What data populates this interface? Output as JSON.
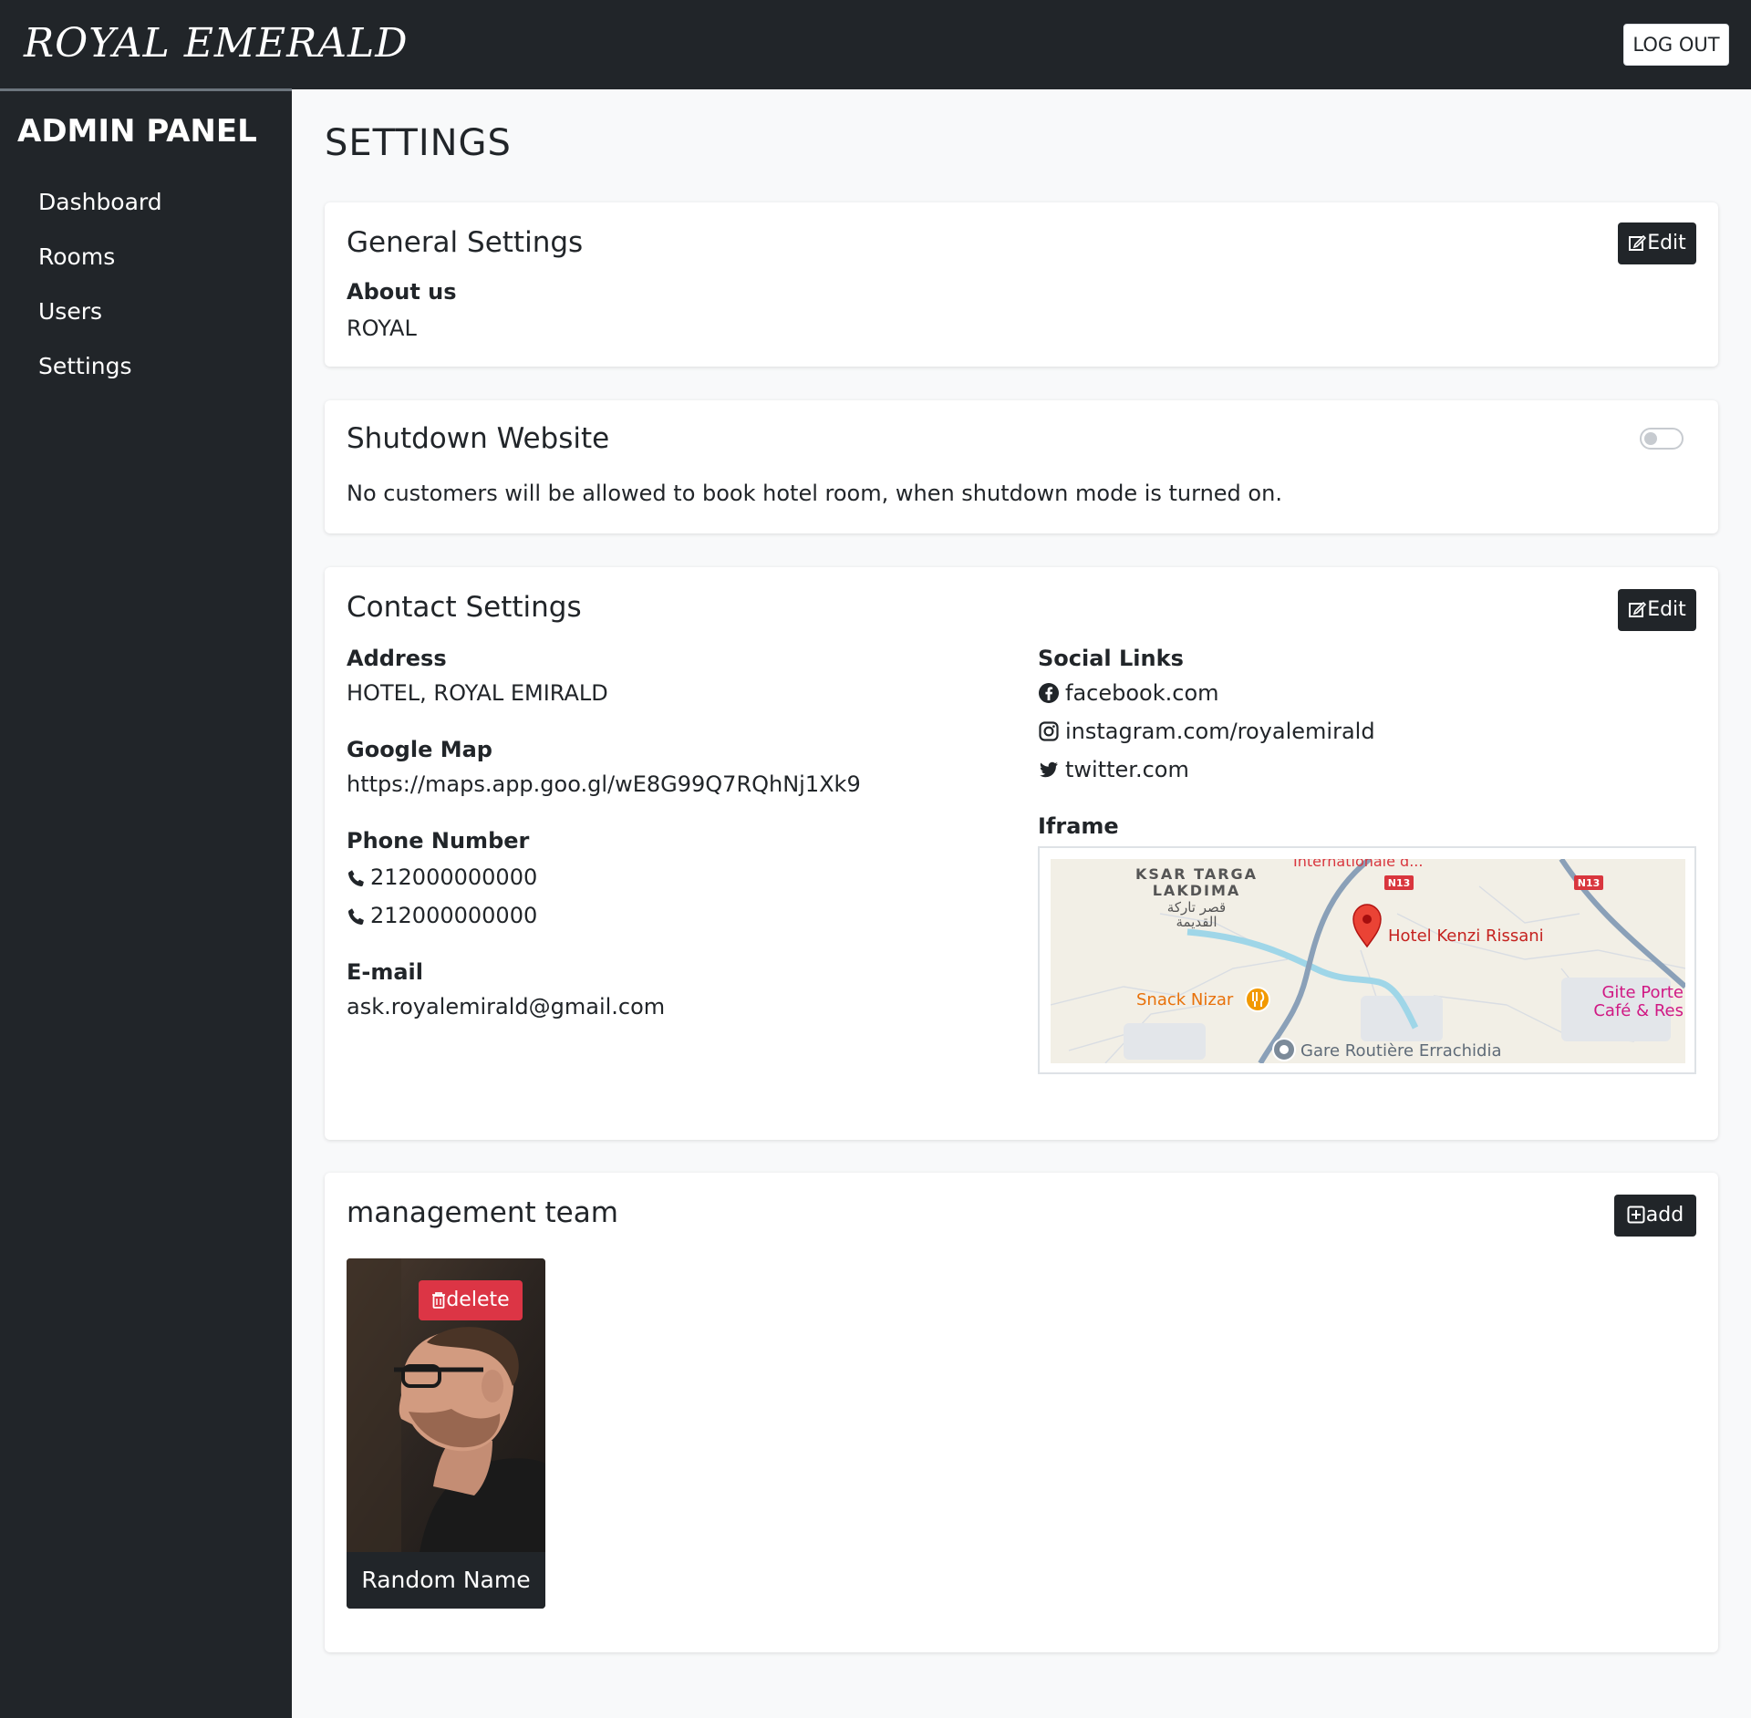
{
  "header": {
    "brand": "ROYAL EMERALD",
    "logout_label": "LOG OUT"
  },
  "sidebar": {
    "title": "ADMIN PANEL",
    "items": [
      {
        "label": "Dashboard"
      },
      {
        "label": "Rooms"
      },
      {
        "label": "Users"
      },
      {
        "label": "Settings"
      }
    ]
  },
  "page": {
    "title": "SETTINGS"
  },
  "general": {
    "title": "General Settings",
    "edit_label": "Edit",
    "about_label": "About us",
    "about_value": "ROYAL"
  },
  "shutdown": {
    "title": "Shutdown Website",
    "description": "No customers will be allowed to book hotel room, when shutdown mode is turned on.",
    "enabled": false
  },
  "contact": {
    "title": "Contact Settings",
    "edit_label": "Edit",
    "address_label": "Address",
    "address_value": "HOTEL, ROYAL EMIRALD",
    "map_label": "Google Map",
    "map_value": "https://maps.app.goo.gl/wE8G99Q7RQhNj1Xk9",
    "phone_label": "Phone Number",
    "phones": [
      "212000000000",
      "212000000000"
    ],
    "email_label": "E-mail",
    "email_value": "ask.royalemirald@gmail.com",
    "social_label": "Social Links",
    "social": [
      {
        "icon": "facebook-icon",
        "text": "facebook.com"
      },
      {
        "icon": "instagram-icon",
        "text": "instagram.com/royalemirald"
      },
      {
        "icon": "twitter-icon",
        "text": "twitter.com"
      }
    ],
    "iframe_label": "Iframe",
    "map_labels": {
      "district_1": "KSAR TARGA",
      "district_2": "LAKDIMA",
      "district_ar_1": "قصر تاركة",
      "district_ar_2": "القديمة",
      "top_place": "Internationale d...",
      "hotel": "Hotel Kenzi Rissani",
      "snack": "Snack Nizar",
      "station": "Gare Routière Errachidia",
      "gite_1": "Gite Porte",
      "gite_2": "Café & Res",
      "road_1": "N13",
      "road_2": "N13"
    }
  },
  "team": {
    "title": "management team",
    "add_label": "add",
    "members": [
      {
        "name": "Random Name",
        "delete_label": "delete"
      }
    ]
  },
  "colors": {
    "dark": "#212529",
    "danger": "#dc3545",
    "background": "#f8f9fa"
  }
}
